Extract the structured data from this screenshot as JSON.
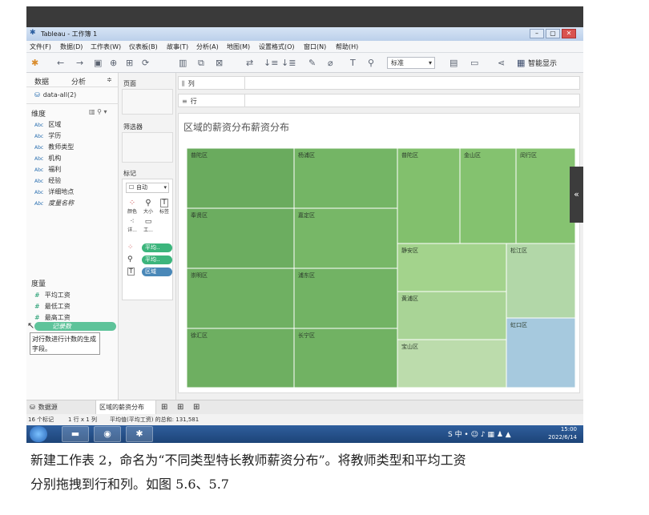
{
  "app": {
    "title": "Tableau - 工作簿 1",
    "win_controls": [
      "–",
      "▢",
      "✕"
    ]
  },
  "menu": [
    "文件(F)",
    "数据(D)",
    "工作表(W)",
    "仪表板(B)",
    "故事(T)",
    "分析(A)",
    "地图(M)",
    "设置格式(O)",
    "窗口(N)",
    "帮助(H)"
  ],
  "toolbar": {
    "std_select": "标准",
    "smart_show": "智能显示"
  },
  "datapane": {
    "tab_data": "数据",
    "tab_analysis": "分析",
    "source": "data-all(2)",
    "dim_header": "维度",
    "dimensions": [
      "区域",
      "学历",
      "教师类型",
      "机构",
      "福利",
      "经验",
      "详细地点",
      "度量名称"
    ],
    "measure_header": "度量",
    "measures": [
      "平均工资",
      "最低工资",
      "最高工资"
    ],
    "records": "记录数",
    "tooltip": "对行数进行计数的生成字段。"
  },
  "cards": {
    "pages": "页面",
    "filters": "筛选器",
    "marks": "标记",
    "mark_type": "自动",
    "color": "颜色",
    "size": "大小",
    "label": "标签",
    "detail": "详...",
    "tooltip": "工...",
    "pill_color": "平均..",
    "pill_size": "平均..",
    "pill_label": "区域"
  },
  "shelves": {
    "columns": "列",
    "rows": "行"
  },
  "view": {
    "title": "区域的薪资分布薪资分布"
  },
  "chart_data": {
    "type": "treemap",
    "title": "区域的薪资分布薪资分布",
    "cells": [
      {
        "name": "普陀区",
        "color": "#6aab5e"
      },
      {
        "name": "杨浦区",
        "color": "#74b565"
      },
      {
        "name": "奉贤区",
        "color": "#6cad60"
      },
      {
        "name": "嘉定区",
        "color": "#77b767"
      },
      {
        "name": "崇明区",
        "color": "#6fb062"
      },
      {
        "name": "浦东区",
        "color": "#72b364"
      },
      {
        "name": "徐汇区",
        "color": "#6eaf61"
      },
      {
        "name": "长宁区",
        "color": "#71b263"
      },
      {
        "name": "普陀区",
        "color": "#82c06d"
      },
      {
        "name": "金山区",
        "color": "#84c26f"
      },
      {
        "name": "闵行区",
        "color": "#86c371"
      },
      {
        "name": "静安区",
        "color": "#a3d38c"
      },
      {
        "name": "松江区",
        "color": "#b2d7a8"
      },
      {
        "name": "黄浦区",
        "color": "#a9d496"
      },
      {
        "name": "宝山区",
        "color": "#bcdcac"
      },
      {
        "name": "虹口区",
        "color": "#a6c9de"
      }
    ]
  },
  "sheetbar": {
    "datasource": "数据源",
    "active_sheet": "区域的薪资分布"
  },
  "status": {
    "marks": "16 个标记",
    "rowscols": "1 行 x 1 列",
    "sum": "平均值(平均工资) 的总和: 131,581"
  },
  "taskbar": {
    "time": "15:00",
    "date": "2022/6/14"
  },
  "caption": {
    "line1": "新建工作表 2，命名为“不同类型特长教师薪资分布”。将教师类型和平均工资",
    "line2": "分别拖拽到行和列。如图 5.6、5.7"
  }
}
